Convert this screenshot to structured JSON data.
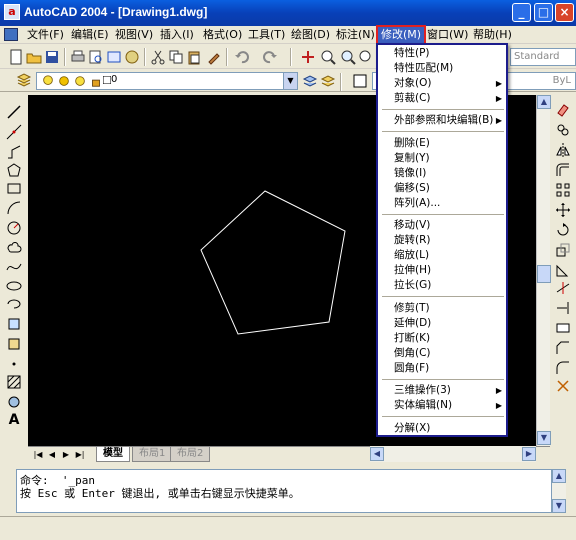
{
  "window": {
    "title": "AutoCAD 2004 - [Drawing1.dwg]",
    "app_icon": "autocad-logo-icon",
    "controls": [
      "minimize",
      "maximize",
      "close"
    ]
  },
  "menubar": {
    "items": [
      {
        "label": "文件(F)",
        "active": false
      },
      {
        "label": "编辑(E)",
        "active": false
      },
      {
        "label": "视图(V)",
        "active": false
      },
      {
        "label": "插入(I)",
        "active": false
      },
      {
        "label": "格式(O)",
        "active": false
      },
      {
        "label": "工具(T)",
        "active": false
      },
      {
        "label": "绘图(D)",
        "active": false
      },
      {
        "label": "标注(N)",
        "active": false
      },
      {
        "label": "修改(M)",
        "active": true
      },
      {
        "label": "窗口(W)",
        "active": false
      },
      {
        "label": "帮助(H)",
        "active": false
      }
    ]
  },
  "toolbar": {
    "text_style": "Standard",
    "layer_value": "0",
    "linetype_value": "ByL"
  },
  "modify_menu": {
    "items": [
      {
        "label": "特性(P)",
        "submenu": false
      },
      {
        "label": "特性匹配(M)",
        "submenu": false
      },
      {
        "label": "对象(O)",
        "submenu": true
      },
      {
        "label": "剪裁(C)",
        "submenu": true
      },
      {
        "sep": true
      },
      {
        "label": "外部参照和块编辑(B)",
        "submenu": true
      },
      {
        "sep": true
      },
      {
        "label": "删除(E)",
        "submenu": false
      },
      {
        "label": "复制(Y)",
        "submenu": false
      },
      {
        "label": "镜像(I)",
        "submenu": false
      },
      {
        "label": "偏移(S)",
        "submenu": false
      },
      {
        "label": "阵列(A)...",
        "submenu": false
      },
      {
        "sep": true
      },
      {
        "label": "移动(V)",
        "submenu": false
      },
      {
        "label": "旋转(R)",
        "submenu": false
      },
      {
        "label": "缩放(L)",
        "submenu": false
      },
      {
        "label": "拉伸(H)",
        "submenu": false
      },
      {
        "label": "拉长(G)",
        "submenu": false
      },
      {
        "sep": true
      },
      {
        "label": "修剪(T)",
        "submenu": false
      },
      {
        "label": "延伸(D)",
        "submenu": false
      },
      {
        "label": "打断(K)",
        "submenu": false
      },
      {
        "label": "倒角(C)",
        "submenu": false
      },
      {
        "label": "圆角(F)",
        "submenu": false
      },
      {
        "sep": true
      },
      {
        "label": "三维操作(3)",
        "submenu": true
      },
      {
        "label": "实体编辑(N)",
        "submenu": true
      },
      {
        "sep": true
      },
      {
        "label": "分解(X)",
        "submenu": false
      }
    ]
  },
  "layout_tabs": [
    {
      "label": "模型",
      "active": true
    },
    {
      "label": "布局1",
      "active": false
    },
    {
      "label": "布局2",
      "active": false
    }
  ],
  "command": {
    "lines": [
      "命令:  '_pan",
      "按 Esc 或 Enter 键退出, 或单击右键显示快捷菜单。"
    ]
  },
  "colors": {
    "canvas": "#000000",
    "shape_stroke": "#ffffff",
    "menu_active": "#3a5fbf",
    "highlight_outline": "#e02020",
    "dropdown_border": "#1c1c8c"
  }
}
